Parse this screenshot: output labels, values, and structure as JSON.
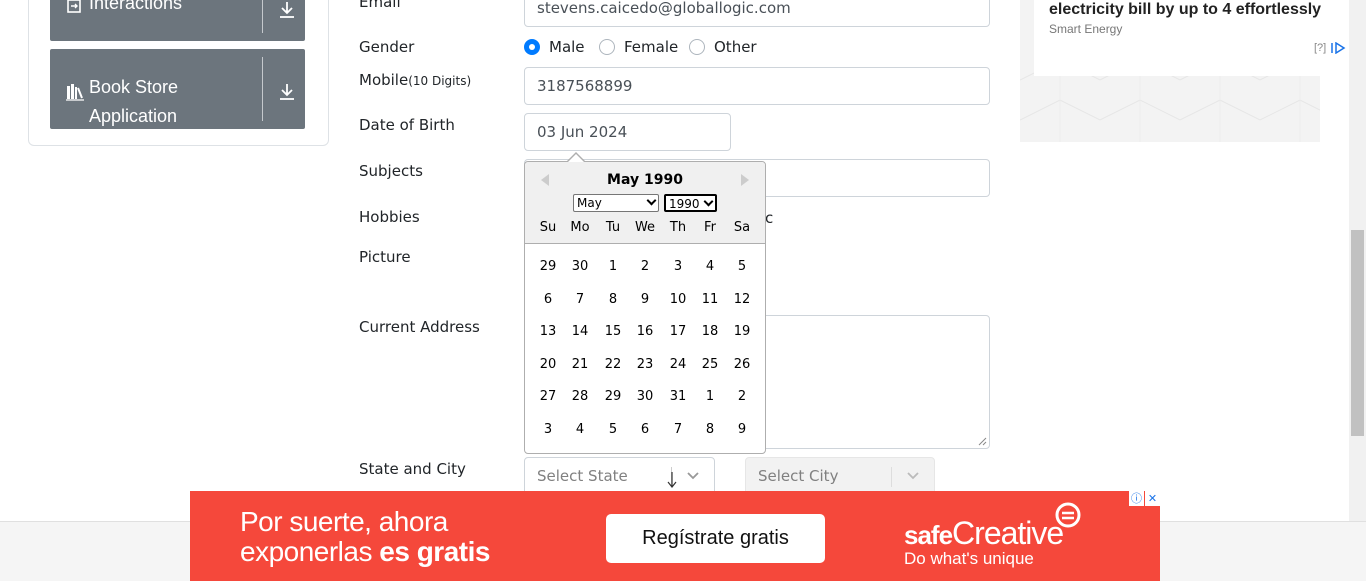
{
  "sidebar": {
    "items": [
      {
        "label": "Interactions",
        "icon": "interactions-icon"
      },
      {
        "label": "Book Store Application",
        "label_line1": "Book Store",
        "label_line2": "Application",
        "icon": "book-store-icon"
      }
    ]
  },
  "form": {
    "email_label": "Email",
    "email_value": "stevens.caicedo@globallogic.com",
    "gender_label": "Gender",
    "gender_options": [
      "Male",
      "Female",
      "Other"
    ],
    "gender_selected": "Male",
    "mobile_label": "Mobile",
    "mobile_hint": "(10 Digits)",
    "mobile_value": "3187568899",
    "dob_label": "Date of Birth",
    "dob_value": "03 Jun 2024",
    "subjects_label": "Subjects",
    "hobbies_label": "Hobbies",
    "hobbies_partial": "c",
    "picture_label": "Picture",
    "address_label": "Current Address",
    "state_city_label": "State and City",
    "state_placeholder": "Select State",
    "city_placeholder": "Select City"
  },
  "datepicker": {
    "title": "May 1990",
    "month_select": "May",
    "year_select": "1990",
    "weekdays": [
      "Su",
      "Mo",
      "Tu",
      "We",
      "Th",
      "Fr",
      "Sa"
    ],
    "weeks": [
      [
        "29",
        "30",
        "1",
        "2",
        "3",
        "4",
        "5"
      ],
      [
        "6",
        "7",
        "8",
        "9",
        "10",
        "11",
        "12"
      ],
      [
        "13",
        "14",
        "15",
        "16",
        "17",
        "18",
        "19"
      ],
      [
        "20",
        "21",
        "22",
        "23",
        "24",
        "25",
        "26"
      ],
      [
        "27",
        "28",
        "29",
        "30",
        "31",
        "1",
        "2"
      ],
      [
        "3",
        "4",
        "5",
        "6",
        "7",
        "8",
        "9"
      ]
    ]
  },
  "ad_top": {
    "headline": "electricity bill by up to 4 effortlessly",
    "sponsor": "Smart Energy",
    "help": "[?]"
  },
  "banner": {
    "text_line1": "Por suerte, ahora",
    "text_line2_a": "exponerlas ",
    "text_line2_b": "es gratis",
    "cta": "Regístrate gratis",
    "brand_a": "safe",
    "brand_b": "Creative",
    "tagline": "Do what's unique",
    "info_icon": "ⓘ",
    "close_icon": "✕"
  },
  "colors": {
    "primary": "#007bff",
    "sidebar_item": "#6c757d",
    "banner": "#f5483b"
  }
}
